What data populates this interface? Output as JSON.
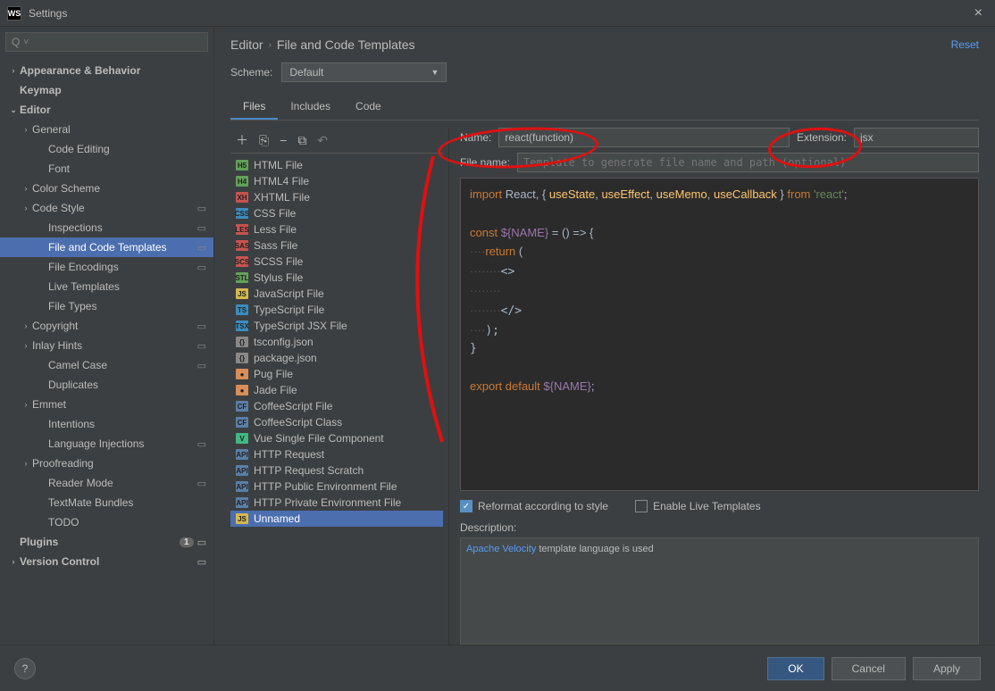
{
  "window": {
    "title": "Settings",
    "appAbbrev": "WS"
  },
  "search": {
    "placeholder": ""
  },
  "sidebar": [
    {
      "label": "Appearance & Behavior",
      "chevron": "›",
      "bold": true,
      "indent": 0
    },
    {
      "label": "Keymap",
      "bold": true,
      "indent": 0
    },
    {
      "label": "Editor",
      "chevron": "⌄",
      "bold": true,
      "indent": 0
    },
    {
      "label": "General",
      "chevron": "›",
      "indent": 1
    },
    {
      "label": "Code Editing",
      "indent": 2
    },
    {
      "label": "Font",
      "indent": 2
    },
    {
      "label": "Color Scheme",
      "chevron": "›",
      "indent": 1
    },
    {
      "label": "Code Style",
      "chevron": "›",
      "indent": 1,
      "cfg": true
    },
    {
      "label": "Inspections",
      "indent": 2,
      "cfg": true
    },
    {
      "label": "File and Code Templates",
      "indent": 2,
      "selected": true,
      "cfg": true
    },
    {
      "label": "File Encodings",
      "indent": 2,
      "cfg": true
    },
    {
      "label": "Live Templates",
      "indent": 2
    },
    {
      "label": "File Types",
      "indent": 2
    },
    {
      "label": "Copyright",
      "chevron": "›",
      "indent": 1,
      "cfg": true
    },
    {
      "label": "Inlay Hints",
      "chevron": "›",
      "indent": 1,
      "cfg": true
    },
    {
      "label": "Camel Case",
      "indent": 2,
      "cfg": true
    },
    {
      "label": "Duplicates",
      "indent": 2
    },
    {
      "label": "Emmet",
      "chevron": "›",
      "indent": 1
    },
    {
      "label": "Intentions",
      "indent": 2
    },
    {
      "label": "Language Injections",
      "indent": 2,
      "cfg": true
    },
    {
      "label": "Proofreading",
      "chevron": "›",
      "indent": 1
    },
    {
      "label": "Reader Mode",
      "indent": 2,
      "cfg": true
    },
    {
      "label": "TextMate Bundles",
      "indent": 2
    },
    {
      "label": "TODO",
      "indent": 2
    },
    {
      "label": "Plugins",
      "bold": true,
      "indent": 0,
      "count": "1",
      "cfg": true
    },
    {
      "label": "Version Control",
      "chevron": "›",
      "bold": true,
      "indent": 0,
      "cfg": true
    }
  ],
  "breadcrumb": {
    "parent": "Editor",
    "current": "File and Code Templates",
    "reset": "Reset"
  },
  "scheme": {
    "label": "Scheme:",
    "value": "Default"
  },
  "tabs": [
    {
      "label": "Files",
      "active": true
    },
    {
      "label": "Includes"
    },
    {
      "label": "Code"
    }
  ],
  "templates": [
    {
      "label": "HTML File",
      "color": "#61a15a",
      "text": "H5"
    },
    {
      "label": "HTML4 File",
      "color": "#61a15a",
      "text": "H4"
    },
    {
      "label": "XHTML File",
      "color": "#c75450",
      "text": "XH"
    },
    {
      "label": "CSS File",
      "color": "#3b8dbd",
      "text": "CSS"
    },
    {
      "label": "Less File",
      "color": "#c75450",
      "text": "LES"
    },
    {
      "label": "Sass File",
      "color": "#c75450",
      "text": "SAS"
    },
    {
      "label": "SCSS File",
      "color": "#c75450",
      "text": "SCS"
    },
    {
      "label": "Stylus File",
      "color": "#61a15a",
      "text": "STL"
    },
    {
      "label": "JavaScript File",
      "color": "#d6b84e",
      "text": "JS"
    },
    {
      "label": "TypeScript File",
      "color": "#3b8dbd",
      "text": "TS"
    },
    {
      "label": "TypeScript JSX File",
      "color": "#3b8dbd",
      "text": "TSX"
    },
    {
      "label": "tsconfig.json",
      "color": "#888",
      "text": "{}"
    },
    {
      "label": "package.json",
      "color": "#888",
      "text": "{}"
    },
    {
      "label": "Pug File",
      "color": "#d68f5a",
      "text": "●"
    },
    {
      "label": "Jade File",
      "color": "#d68f5a",
      "text": "●"
    },
    {
      "label": "CoffeeScript File",
      "color": "#5b7fa6",
      "text": "CF"
    },
    {
      "label": "CoffeeScript Class",
      "color": "#5b7fa6",
      "text": "CF"
    },
    {
      "label": "Vue Single File Component",
      "color": "#41b883",
      "text": "V"
    },
    {
      "label": "HTTP Request",
      "color": "#5b7fa6",
      "text": "API"
    },
    {
      "label": "HTTP Request Scratch",
      "color": "#5b7fa6",
      "text": "API"
    },
    {
      "label": "HTTP Public Environment File",
      "color": "#5b7fa6",
      "text": "API"
    },
    {
      "label": "HTTP Private Environment File",
      "color": "#5b7fa6",
      "text": "API"
    },
    {
      "label": "Unnamed",
      "color": "#d6b84e",
      "text": "JS",
      "selected": true
    }
  ],
  "form": {
    "nameLabel": "Name:",
    "nameValue": "react(function)",
    "extLabel": "Extension:",
    "extValue": "jsx",
    "fileNameLabel": "File name:",
    "fileNamePlaceholder": "Template to generate file name and path (optional)"
  },
  "code": {
    "line1a": "import",
    "line1b": " React",
    "line1c": ", { ",
    "line1d": "useState",
    "line1e": ", ",
    "line1f": "useEffect",
    "line1g": ", ",
    "line1h": "useMemo",
    "line1i": ", ",
    "line1j": "useCallback",
    "line1k": " } ",
    "line1l": "from",
    "line1m": " 'react'",
    "line1n": ";",
    "line2a": "const ",
    "line2b": "${NAME}",
    "line2c": " = () => {",
    "line3a": "    return",
    "line3b": " (",
    "line4": "        <>",
    "line5": "        ",
    "line6": "        </>",
    "line7": "    );",
    "line8": "}",
    "line9a": "export default ",
    "line9b": "${NAME}",
    "line9c": ";"
  },
  "options": {
    "reformat": "Reformat according to style",
    "liveTemplates": "Enable Live Templates"
  },
  "description": {
    "label": "Description:",
    "link": "Apache Velocity",
    "text": " template language is used"
  },
  "footer": {
    "ok": "OK",
    "cancel": "Cancel",
    "apply": "Apply"
  }
}
